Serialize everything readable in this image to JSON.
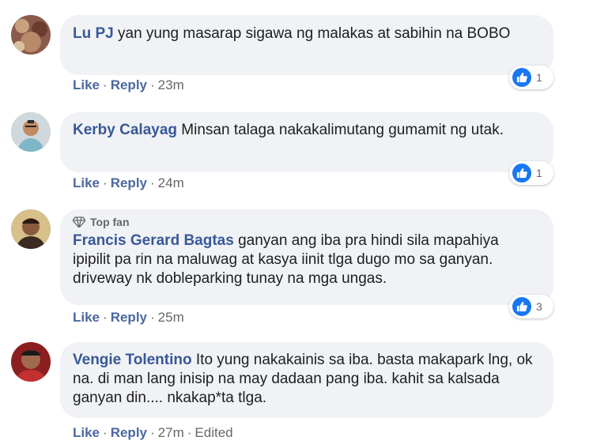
{
  "colors": {
    "author": "#385898",
    "action": "#4b67a1",
    "bubble": "#f0f2f5",
    "like_blue": "#1877f2"
  },
  "comments": [
    {
      "author": "Lu PJ",
      "text": "yan yung masarap sigawa ng malakas at sabihin na BOBO",
      "like_label": "Like",
      "reply_label": "Reply",
      "time": "23m",
      "reaction_icon": "like-icon",
      "reaction_count": "1"
    },
    {
      "author": "Kerby Calayag",
      "text": "Minsan talaga nakakalimutang gumamit ng utak.",
      "like_label": "Like",
      "reply_label": "Reply",
      "time": "24m",
      "reaction_icon": "like-icon",
      "reaction_count": "1"
    },
    {
      "badge": "Top fan",
      "badge_icon": "diamond-icon",
      "author": "Francis Gerard Bagtas",
      "text": "ganyan ang iba pra hindi sila mapahiya ipipilit pa rin na maluwag at kasya iinit tlga dugo mo sa ganyan. driveway nk dobleparking tunay na mga ungas.",
      "like_label": "Like",
      "reply_label": "Reply",
      "time": "25m",
      "reaction_icon": "like-icon",
      "reaction_count": "3"
    },
    {
      "author": "Vengie Tolentino",
      "text": "Ito yung nakakainis sa iba. basta makapark lng, ok na. di man lang inisip na may dadaan pang iba. kahit sa kalsada ganyan din.... nkakap*ta tlga.",
      "like_label": "Like",
      "reply_label": "Reply",
      "time": "27m",
      "edited": "Edited"
    }
  ]
}
